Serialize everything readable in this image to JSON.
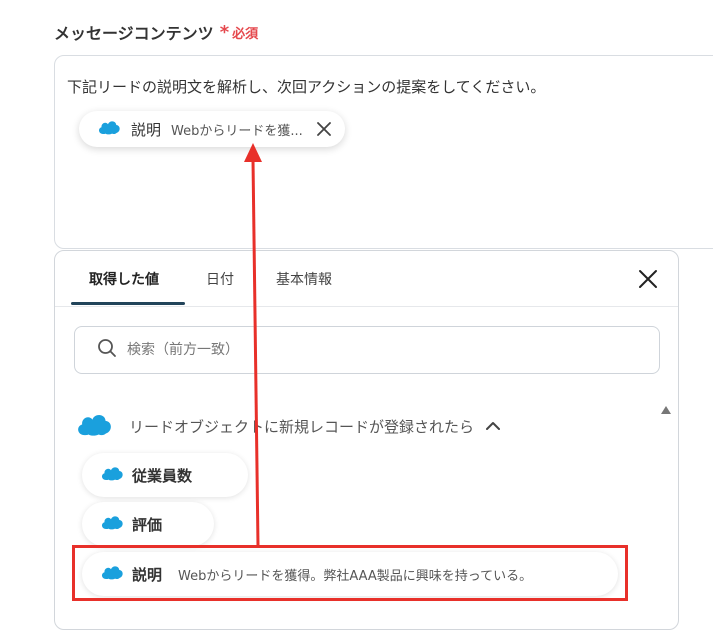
{
  "field": {
    "label": "メッセージコンテンツ",
    "required_star": "*",
    "required_text": "必須"
  },
  "editor": {
    "text": "下記リードの説明文を解析し、次回アクションの提案をしてください。",
    "chip": {
      "icon": "salesforce-cloud-icon",
      "name": "説明",
      "value": "Webからリードを獲..."
    }
  },
  "panel": {
    "tabs": [
      {
        "label": "取得した値",
        "active": true
      },
      {
        "label": "日付",
        "active": false
      },
      {
        "label": "基本情報",
        "active": false
      }
    ],
    "search": {
      "placeholder": "検索（前方一致）"
    },
    "group": {
      "title": "リードオブジェクトに新規レコードが登録されたら",
      "expanded": true
    },
    "items": [
      {
        "name": "従業員数",
        "value": ""
      },
      {
        "name": "評価",
        "value": ""
      },
      {
        "name": "説明",
        "value": "Webからリードを獲得。弊社AAA製品に興味を持っている。"
      }
    ]
  },
  "colors": {
    "salesforce_blue": "#1aa0dd",
    "required_red": "#e5484d",
    "annotation_red": "#e8302a",
    "tab_underline": "#22445a"
  }
}
